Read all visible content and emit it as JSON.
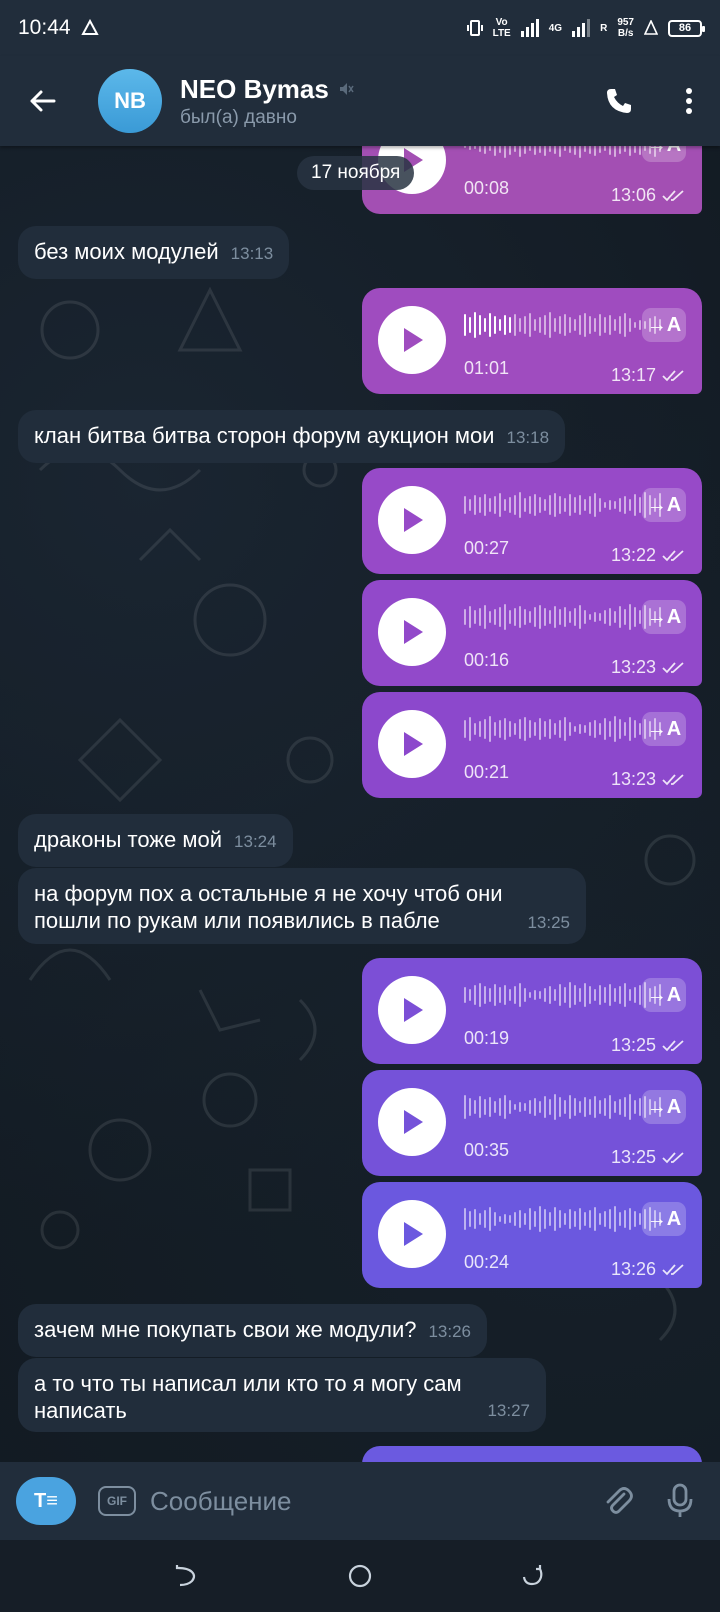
{
  "status_bar": {
    "time": "10:44",
    "volte": "Vo\nLTE",
    "net_4g": "4G",
    "net_r": "R",
    "speed_value": "957",
    "speed_unit": "B/s",
    "battery": "86"
  },
  "header": {
    "avatar_initials": "NB",
    "name": "NEO Bymas",
    "status": "был(а) давно",
    "muted": true
  },
  "date_separator": "17 ноября",
  "messages": [
    {
      "type": "voice",
      "duration": "00:08",
      "time": "13:06",
      "color": "#a34fb3",
      "read": true
    },
    {
      "type": "text",
      "text": "без моих модулей",
      "time": "13:13"
    },
    {
      "type": "voice",
      "duration": "01:01",
      "time": "13:17",
      "color": "#9f4cbf",
      "read": true
    },
    {
      "type": "text",
      "text": "клан битва битва сторон форум аукцион мои",
      "time": "13:18"
    },
    {
      "type": "voice",
      "duration": "00:27",
      "time": "13:22",
      "color": "#974ac8",
      "read": true
    },
    {
      "type": "voice",
      "duration": "00:16",
      "time": "13:23",
      "color": "#9249ca",
      "read": true
    },
    {
      "type": "voice",
      "duration": "00:21",
      "time": "13:23",
      "color": "#8c48cc",
      "read": true
    },
    {
      "type": "text",
      "text": "драконы тоже мой",
      "time": "13:24"
    },
    {
      "type": "text",
      "text": "на форум пох а остальные я не хочу чтоб они пошли по рукам или появились в пабле",
      "line1": "на форум пох а остальные я не хочу чтоб они",
      "line2": "пошли по рукам или появились в пабле",
      "time": "13:25"
    },
    {
      "type": "voice",
      "duration": "00:19",
      "time": "13:25",
      "color": "#7c4fd6",
      "read": true
    },
    {
      "type": "voice",
      "duration": "00:35",
      "time": "13:25",
      "color": "#7552d9",
      "read": true
    },
    {
      "type": "voice",
      "duration": "00:24",
      "time": "13:26",
      "color": "#6b58df",
      "read": true
    },
    {
      "type": "text",
      "text": "зачем мне покупать свои же модули?",
      "time": "13:26"
    },
    {
      "type": "text",
      "text": "а то что ты написал или кто то я могу сам написать",
      "line1": "а то что ты написал или кто то я могу сам",
      "line2": "написать",
      "time": "13:27"
    }
  ],
  "transcribe_label": "→A",
  "composer": {
    "placeholder": "Сообщение",
    "gif_label": "GIF",
    "format_label": "T≡"
  },
  "colors": {
    "header_bg": "#212d3b",
    "incoming_bubble": "#212d3b",
    "accent": "#4aa3e0"
  }
}
